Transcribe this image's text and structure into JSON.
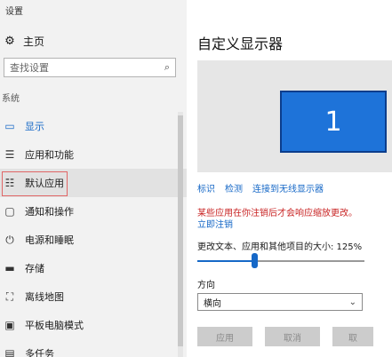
{
  "window": {
    "title": "设置"
  },
  "sidebar": {
    "home": {
      "icon": "gear-icon",
      "label": "主页"
    },
    "search": {
      "placeholder": "查找设置",
      "icon": "search-icon"
    },
    "section": "系统",
    "items": [
      {
        "icon": "display-icon",
        "label": "显示",
        "active": true
      },
      {
        "icon": "apps-list-icon",
        "label": "应用和功能"
      },
      {
        "icon": "default-apps-icon",
        "label": "默认应用",
        "hovered": true
      },
      {
        "icon": "notification-icon",
        "label": "通知和操作"
      },
      {
        "icon": "power-icon",
        "label": "电源和睡眠"
      },
      {
        "icon": "storage-icon",
        "label": "存储"
      },
      {
        "icon": "offline-maps-icon",
        "label": "离线地图"
      },
      {
        "icon": "tablet-mode-icon",
        "label": "平板电脑模式"
      },
      {
        "icon": "multitasking-icon",
        "label": "多任务"
      }
    ]
  },
  "main": {
    "title": "自定义显示器",
    "monitor_number": "1",
    "links": [
      "标识",
      "检测",
      "连接到无线显示器"
    ],
    "warning": "某些应用在你注销后才会响应缩放更改。",
    "signout_link": "立即注销",
    "scale_label": "更改文本、应用和其他项目的大小: 125%",
    "scale_slider_fraction": 0.34,
    "orientation_label": "方向",
    "orientation_value": "横向",
    "buttons": {
      "apply": "应用",
      "cancel": "取消",
      "third": "取"
    }
  },
  "colors": {
    "accent": "#1668c7",
    "warning": "#c82323",
    "monitor": "#1e73d9"
  }
}
